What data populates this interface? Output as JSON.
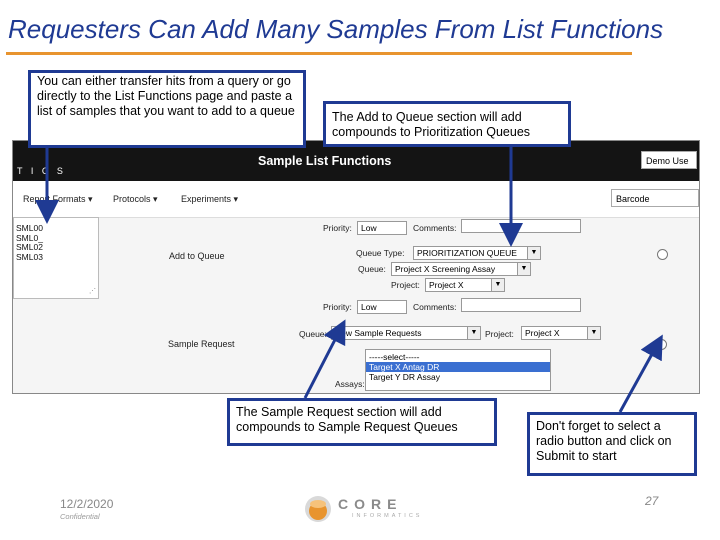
{
  "slide": {
    "title": "Requesters Can Add Many Samples From List Functions",
    "callouts": {
      "c1": "You can either transfer hits from a query or go directly to the List Functions page and paste a list of samples that you want to add to a queue",
      "c2": "The Add to Queue section will add compounds to Prioritization Queues",
      "c3": "The Sample Request section will add compounds to Sample Request Queues",
      "c4": "Don't forget to select a radio button and click on Submit to start"
    },
    "footer": {
      "date": "12/2/2020",
      "confidential": "Confidential",
      "page": "27",
      "logo_text": "CORE",
      "logo_subtext": "INFORMATICS"
    },
    "colors": {
      "title": "#1f3a93",
      "rule": "#e8942e",
      "callout_border": "#1f3a93",
      "arrow": "#1f3a93"
    }
  },
  "app": {
    "header_title": "Sample List Functions",
    "header_fragment": "T I C S",
    "user_select": "Demo Use",
    "menu": [
      "Report Formats ▾",
      "Protocols ▾",
      "Experiments ▾"
    ],
    "barcode_select": "Barcode",
    "samples": [
      "SML00",
      "SML0_",
      "SML02",
      "SML03"
    ],
    "add_to_queue": {
      "label": "Add to Queue",
      "priority_label": "Priority:",
      "priority_value": "Low",
      "comments_label": "Comments:",
      "queue_type_label": "Queue Type:",
      "queue_type_value": "PRIORITIZATION QUEUE",
      "queue_label": "Queue:",
      "queue_value": "Project X Screening Assay",
      "project_label": "Project:",
      "project_value": "Project X"
    },
    "sample_request": {
      "label": "Sample Request",
      "priority_label": "Priority:",
      "priority_value": "Low",
      "comments_label": "Comments:",
      "queue_label": "Queue:",
      "queue_value": "New Sample Requests",
      "project_label": "Project:",
      "project_value": "Project X",
      "assays_label": "Assays:",
      "assay_options": [
        "-----select-----",
        "Target X Antag DR",
        "Target Y DR Assay"
      ],
      "assay_selected_index": 1
    }
  }
}
